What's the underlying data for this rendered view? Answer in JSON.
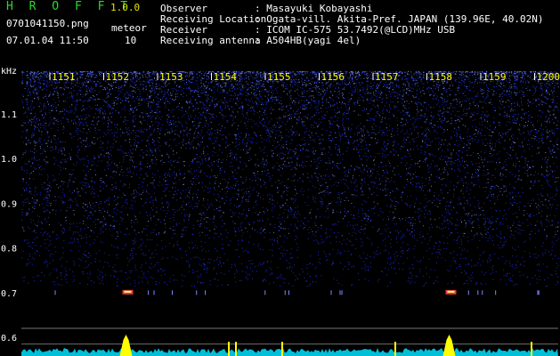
{
  "header": {
    "app_title": "H R O F F T",
    "version": "1.0.0",
    "filename": "0701041150.png",
    "datetime": "07.01.04 11:50",
    "meteor_label": "meteor",
    "meteor_count": "10",
    "meta": [
      {
        "label": "Observer",
        "value": ": Masayuki Kobayashi"
      },
      {
        "label": "Receiving Location",
        "value": ": Ogata-vill. Akita-Pref. JAPAN (139.96E, 40.02N)"
      },
      {
        "label": "Receiver",
        "value": ": ICOM IC-575 53.7492(@LCD)MHz USB"
      },
      {
        "label": "Receiving antenna",
        "value": ": A504HB(yagi 4el)"
      }
    ]
  },
  "colors": {
    "background": "#000000",
    "title": "#2bd92b",
    "version": "#e6e600",
    "tick_label": "#ffff00",
    "noise": "#1a2bd0",
    "meteor_trace": "#ff4040",
    "signal": "#00e0ff",
    "peak": "#ffff00"
  },
  "chart_data": {
    "type": "heatmap",
    "y_unit_label": "kHz",
    "y_ticks": [
      "1.1",
      "1.0",
      "0.9",
      "0.8",
      "0.7",
      "0.6"
    ],
    "x_ticks": [
      "1151",
      "1152",
      "1153",
      "1154",
      "1155",
      "1156",
      "1157",
      "1158",
      "1159",
      "1200"
    ],
    "ylim": [
      0.58,
      1.18
    ],
    "meteor_traces": [
      {
        "time": "1152",
        "freq": 0.7
      },
      {
        "time": "1158",
        "freq": 0.7
      }
    ]
  }
}
